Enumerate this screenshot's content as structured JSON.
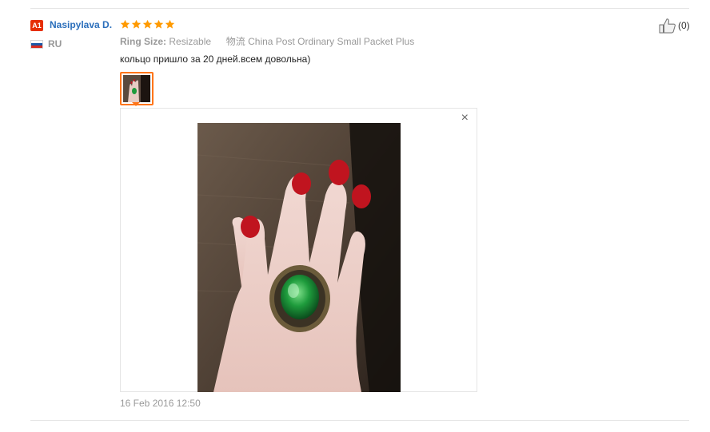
{
  "review": {
    "user_badge": "A1",
    "user_name": "Nasipylava D.",
    "country": "RU",
    "rating": 5,
    "attributes": {
      "ring_size_label": "Ring Size:",
      "ring_size_value": "Resizable",
      "logistics_label": "物流",
      "logistics_value": "China Post Ordinary Small Packet Plus"
    },
    "text": "кольцо пришло за 20 дней.всем довольна)",
    "date": "16 Feb 2016 12:50",
    "helpful_count": "(0)"
  },
  "viewer": {
    "close_glyph": "×"
  },
  "colors": {
    "accent": "#ff7519",
    "star": "#ff9a00",
    "username": "#2a6ebb",
    "badge": "#e62e04",
    "nail_polish": "#c0141f",
    "gem": "#1e9b3c"
  },
  "icons": {
    "flag": "russia-flag-icon",
    "star": "star-icon",
    "thumbs_up": "thumbs-up-icon",
    "close": "close-icon"
  }
}
